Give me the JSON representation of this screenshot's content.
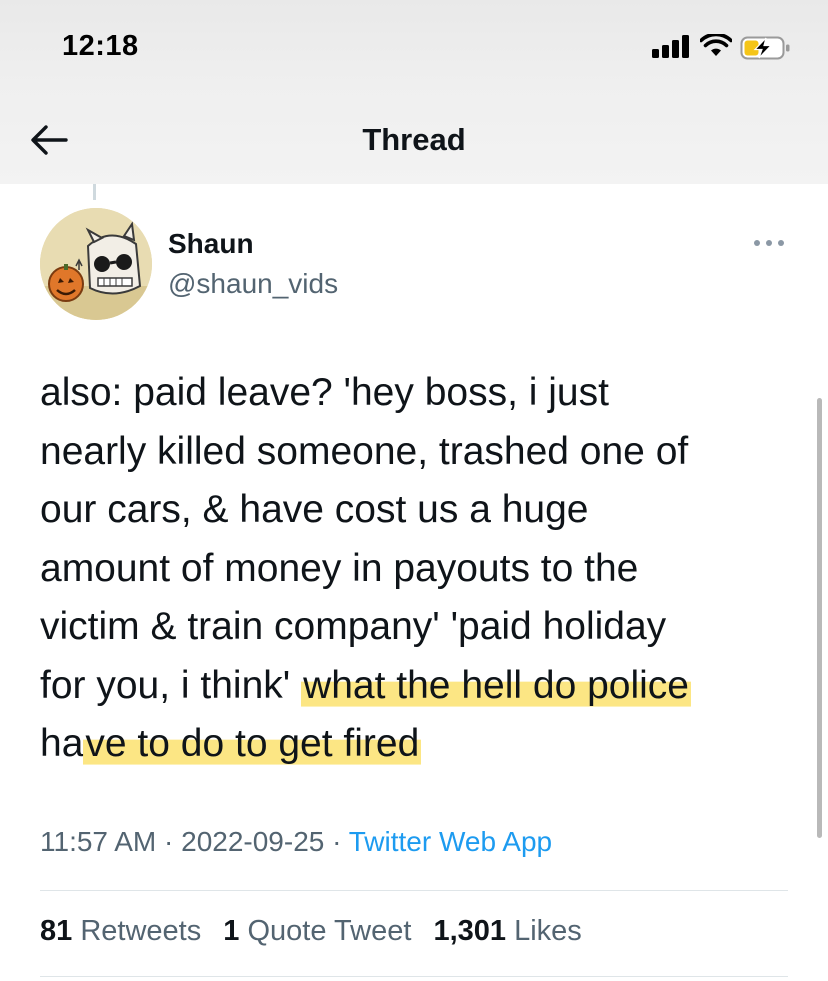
{
  "status_bar": {
    "time": "12:18",
    "icons": [
      "signal-icon",
      "wifi-icon",
      "battery-charging-icon"
    ]
  },
  "header": {
    "title": "Thread",
    "back_icon": "arrow-left-icon"
  },
  "tweet": {
    "author": {
      "display_name": "Shaun",
      "handle": "@shaun_vids"
    },
    "text_segments": {
      "l1": "also: paid leave? 'hey boss, i just",
      "l2": "nearly killed someone, trashed one of",
      "l3": "our cars, & have cost us a huge",
      "l4": "amount of money in payouts to the",
      "l5": "victim & train company' 'paid holiday",
      "l6a": "for you, i think' ",
      "l6b_highlight": "what the hell do police",
      "l7a_highlight_start": "ha",
      "l7b_highlight": "ve to do to get fired"
    },
    "meta": {
      "time": "11:57 AM",
      "separator": "·",
      "date": "2022-09-25",
      "source": "Twitter Web App"
    },
    "stats": {
      "retweets_count": "81",
      "retweets_label": "Retweets",
      "quotes_count": "1",
      "quotes_label": "Quote Tweet",
      "likes_count": "1,301",
      "likes_label": "Likes"
    }
  },
  "colors": {
    "text_primary": "#0f1419",
    "text_secondary": "#536471",
    "link": "#1d9bf0",
    "highlight": "#fce26e"
  }
}
